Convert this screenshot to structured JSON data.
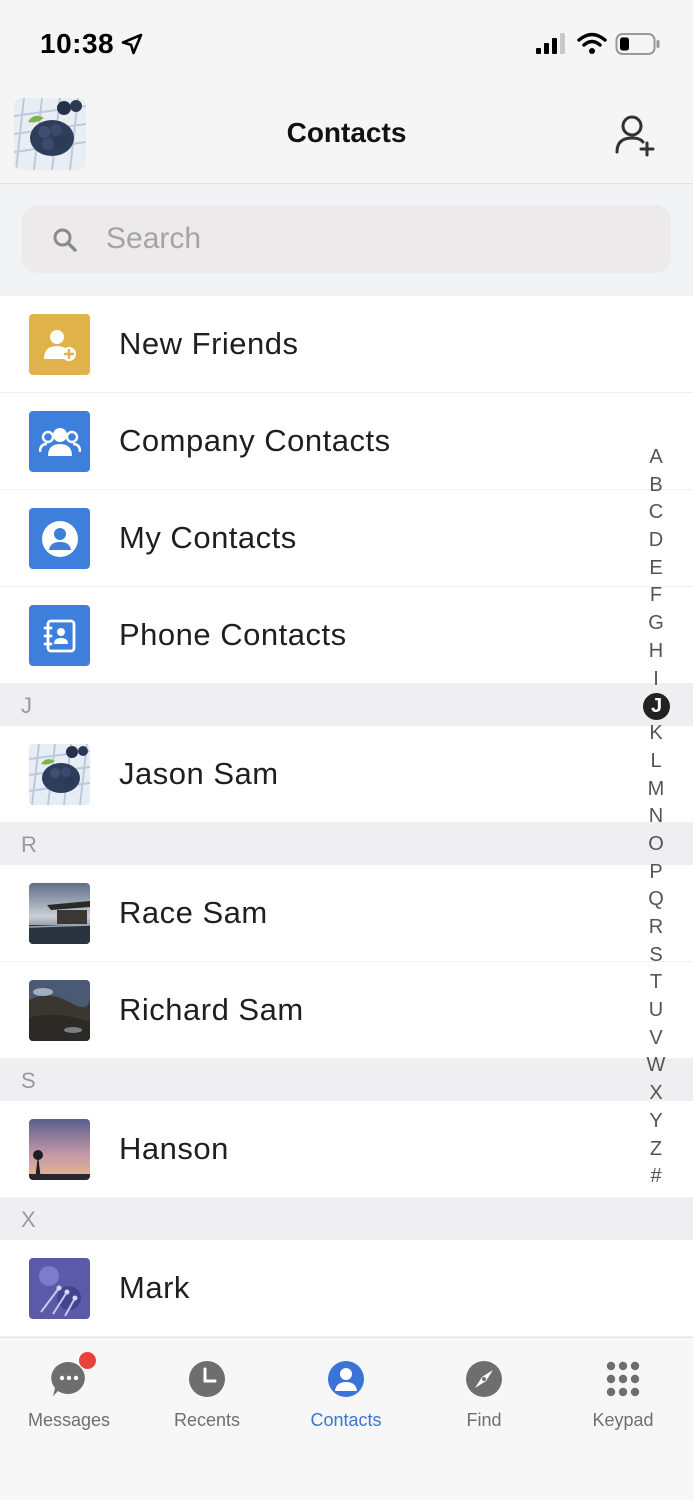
{
  "status_bar": {
    "time": "10:38"
  },
  "header": {
    "title": "Contacts"
  },
  "search": {
    "placeholder": "Search"
  },
  "menu_items": [
    {
      "label": "New Friends",
      "icon": "add-person-icon",
      "color": "#e0b24a"
    },
    {
      "label": "Company Contacts",
      "icon": "group-icon",
      "color": "#3f7fdc"
    },
    {
      "label": "My Contacts",
      "icon": "person-circle-icon",
      "color": "#3f7fdc"
    },
    {
      "label": "Phone Contacts",
      "icon": "address-book-icon",
      "color": "#3f7fdc"
    }
  ],
  "sections": [
    {
      "letter": "J",
      "contacts": [
        "Jason Sam"
      ]
    },
    {
      "letter": "R",
      "contacts": [
        "Race Sam",
        "Richard Sam"
      ]
    },
    {
      "letter": "S",
      "contacts": [
        "Hanson"
      ]
    },
    {
      "letter": "X",
      "contacts": [
        "Mark"
      ]
    }
  ],
  "index_letters": [
    "A",
    "B",
    "C",
    "D",
    "E",
    "F",
    "G",
    "H",
    "I",
    "J",
    "K",
    "L",
    "M",
    "N",
    "O",
    "P",
    "Q",
    "R",
    "S",
    "T",
    "U",
    "V",
    "W",
    "X",
    "Y",
    "Z",
    "#"
  ],
  "index_active": "J",
  "tabs": [
    {
      "label": "Messages",
      "icon": "chat-bubble-icon",
      "badge": true
    },
    {
      "label": "Recents",
      "icon": "clock-icon"
    },
    {
      "label": "Contacts",
      "icon": "person-icon",
      "active": true
    },
    {
      "label": "Find",
      "icon": "compass-icon"
    },
    {
      "label": "Keypad",
      "icon": "keypad-icon"
    }
  ],
  "colors": {
    "accent": "#3b74d6",
    "badge": "#e8433b"
  }
}
